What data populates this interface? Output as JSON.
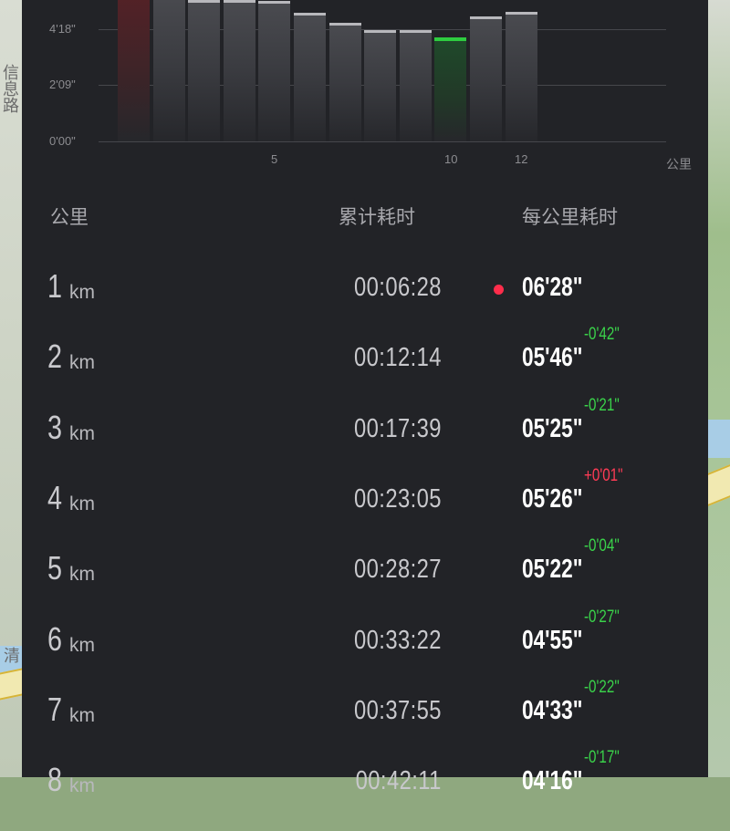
{
  "map": {
    "left_text": "信息路",
    "water_text": "清"
  },
  "chart": {
    "y_ticks": [
      "4'18\"",
      "2'09\"",
      "0'00\""
    ],
    "x_ticks": [
      "5",
      "10",
      "12"
    ],
    "x_unit": "公里"
  },
  "chart_data": {
    "type": "bar",
    "title": "",
    "xlabel": "公里",
    "ylabel": "",
    "categories": [
      "1",
      "2",
      "3",
      "4",
      "5",
      "6",
      "7",
      "8",
      "9",
      "10",
      "11",
      "12"
    ],
    "values_seconds": [
      388,
      346,
      325,
      326,
      322,
      295,
      273,
      256,
      256,
      240,
      288,
      298
    ],
    "ylim_labels": [
      "0'00\"",
      "2'09\"",
      "4'18\""
    ],
    "highlight": {
      "slowest": "1",
      "fastest": "10"
    },
    "colors": {
      "slowest": "#7a2a30",
      "fastest": "#2ecc40",
      "normal": "#b8b8bc"
    }
  },
  "table": {
    "headers": {
      "km": "公里",
      "total": "累计耗时",
      "pace": "每公里耗时"
    },
    "unit": "km",
    "rows": [
      {
        "km": "1",
        "total": "00:06:28",
        "pace": "06'28\"",
        "diff": "",
        "dot": true
      },
      {
        "km": "2",
        "total": "00:12:14",
        "pace": "05'46\"",
        "diff": "-0'42\""
      },
      {
        "km": "3",
        "total": "00:17:39",
        "pace": "05'25\"",
        "diff": "-0'21\""
      },
      {
        "km": "4",
        "total": "00:23:05",
        "pace": "05'26\"",
        "diff": "+0'01\""
      },
      {
        "km": "5",
        "total": "00:28:27",
        "pace": "05'22\"",
        "diff": "-0'04\""
      },
      {
        "km": "6",
        "total": "00:33:22",
        "pace": "04'55\"",
        "diff": "-0'27\""
      },
      {
        "km": "7",
        "total": "00:37:55",
        "pace": "04'33\"",
        "diff": "-0'22\""
      },
      {
        "km": "8",
        "total": "00:42:11",
        "pace": "04'16\"",
        "diff": "-0'17\""
      }
    ]
  },
  "colors": {
    "panel_bg": "#222327",
    "faster": "#3ad24a",
    "slower": "#ff3b55",
    "dot": "#ff2d4b"
  }
}
